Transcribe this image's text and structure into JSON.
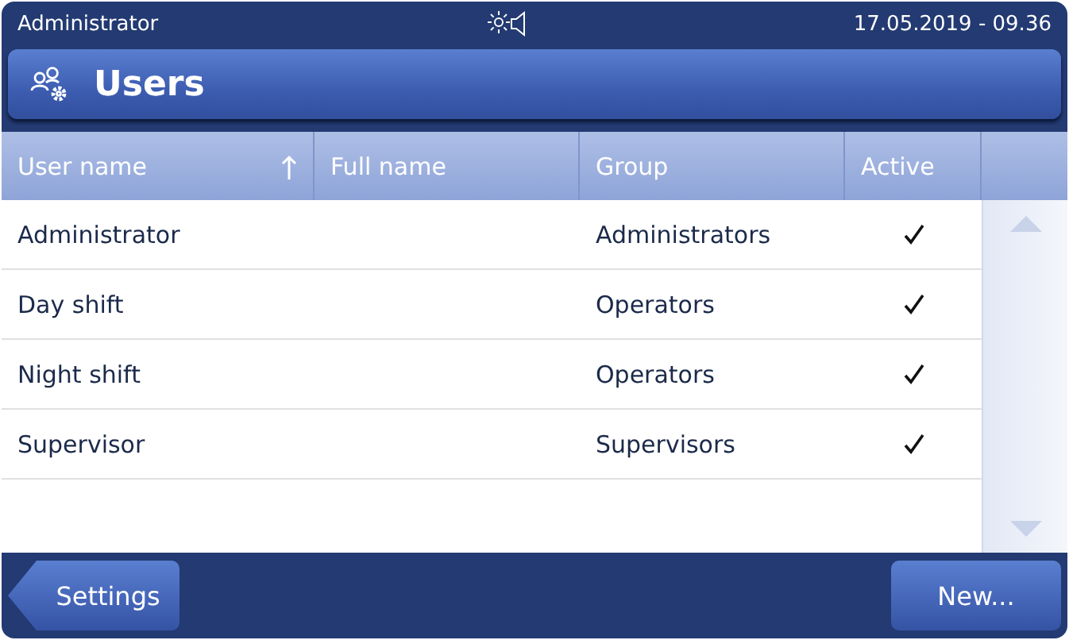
{
  "status_bar": {
    "user": "Administrator",
    "datetime": "17.05.2019 - 09.36"
  },
  "title_bar": {
    "title": "Users"
  },
  "table": {
    "columns": [
      {
        "label": "User name",
        "sorted": true
      },
      {
        "label": "Full name",
        "sorted": false
      },
      {
        "label": "Group",
        "sorted": false
      },
      {
        "label": "Active",
        "sorted": false
      }
    ],
    "rows": [
      {
        "user_name": "Administrator",
        "group": "Administrators",
        "active": true
      },
      {
        "user_name": "Day shift",
        "group": "Operators",
        "active": true
      },
      {
        "user_name": "Night shift",
        "group": "Operators",
        "active": true
      },
      {
        "user_name": "Supervisor",
        "group": "Supervisors",
        "active": true
      }
    ]
  },
  "footer": {
    "back_button": "Settings",
    "new_button": "New..."
  }
}
